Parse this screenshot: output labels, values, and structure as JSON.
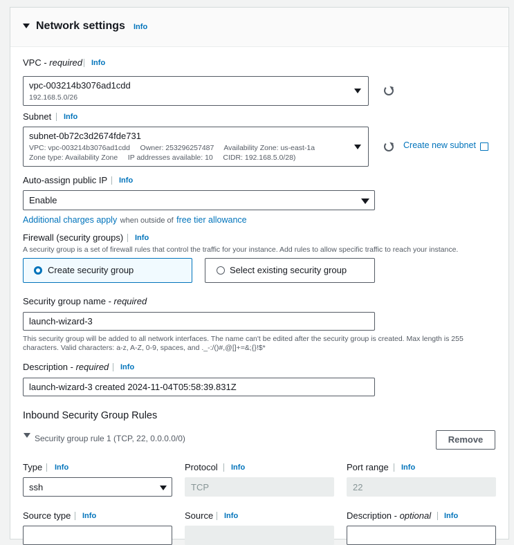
{
  "section": {
    "title": "Network settings",
    "info": "Info"
  },
  "vpc": {
    "label_prefix": "VPC - ",
    "label_italic": "required",
    "info": "Info",
    "value": "vpc-003214b3076ad1cdd",
    "sub": "192.168.5.0/26"
  },
  "subnet": {
    "label": "Subnet",
    "info": "Info",
    "value": "subnet-0b72c3d2674fde731",
    "line1": "VPC: vpc-003214b3076ad1cdd     Owner: 253296257487     Availability Zone: us-east-1a",
    "line2": "Zone type: Availability Zone     IP addresses available: 10     CIDR: 192.168.5.0/28)",
    "create_link": "Create new subnet"
  },
  "auto_assign": {
    "label": "Auto-assign public IP",
    "info": "Info",
    "value": "Enable",
    "charges_link": "Additional charges apply",
    "charges_mid": "when outside of",
    "free_tier_link": "free tier allowance"
  },
  "firewall": {
    "label": "Firewall (security groups)",
    "info": "Info",
    "description": "A security group is a set of firewall rules that control the traffic for your instance. Add rules to allow specific traffic to reach your instance.",
    "option_create": "Create security group",
    "option_existing": "Select existing security group"
  },
  "sg_name": {
    "label_prefix": "Security group name - ",
    "label_italic": "required",
    "value": "launch-wizard-3",
    "help1": "This security group will be added to all network interfaces. The name can't be edited after the security group is created. Max length is 255",
    "help2": "characters. Valid characters: a-z, A-Z, 0-9, spaces, and ._-:/()#,@[]+=&;{}!$*"
  },
  "description": {
    "label_prefix": "Description - ",
    "label_italic": "required",
    "info": "Info",
    "value": "launch-wizard-3 created 2024-11-04T05:58:39.831Z"
  },
  "inbound": {
    "title": "Inbound Security Group Rules",
    "rule_title": "Security group rule 1 (TCP, 22, 0.0.0.0/0)",
    "remove": "Remove"
  },
  "rule": {
    "type_label": "Type",
    "type_info": "Info",
    "type_value": "ssh",
    "protocol_label": "Protocol",
    "protocol_info": "Info",
    "protocol_value": "TCP",
    "port_label": "Port range",
    "port_info": "Info",
    "port_value": "22",
    "source_type_label": "Source type",
    "source_type_info": "Info",
    "source_label": "Source",
    "source_info": "Info",
    "desc_label_prefix": "Description - ",
    "desc_label_italic": "optional",
    "desc_info": "Info"
  }
}
